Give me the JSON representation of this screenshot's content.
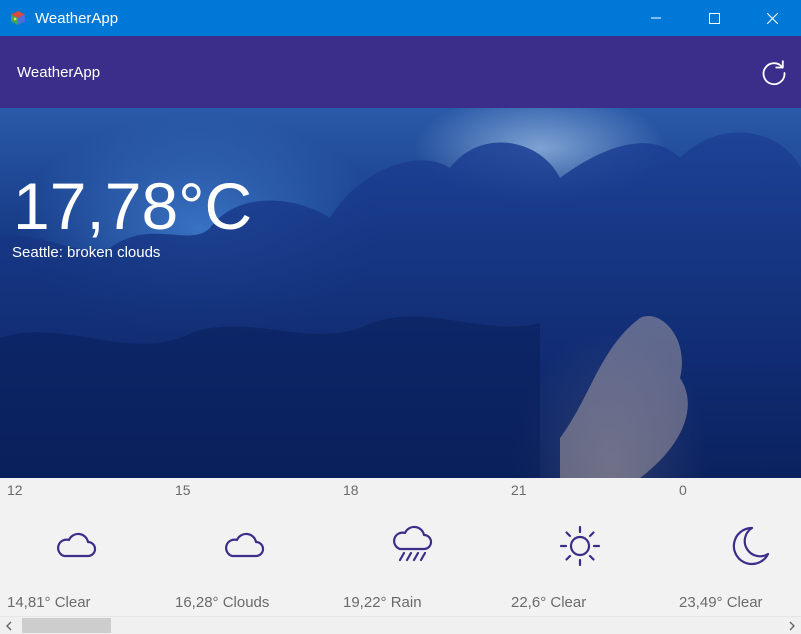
{
  "window": {
    "title": "WeatherApp",
    "titlebar_color": "#0078d7",
    "controls": [
      "minimize-icon",
      "maximize-icon",
      "close-icon"
    ]
  },
  "header": {
    "title": "WeatherApp",
    "background": "#3b2d8a",
    "refresh_icon": "refresh-icon"
  },
  "current": {
    "temperature": "17,78°C",
    "description": "Seattle: broken clouds"
  },
  "forecast": {
    "accent": "#3b2d8a",
    "items": [
      {
        "hour": "12",
        "icon": "cloud-icon",
        "summary": "14,81° Clear"
      },
      {
        "hour": "15",
        "icon": "cloud-icon",
        "summary": "16,28° Clouds"
      },
      {
        "hour": "18",
        "icon": "rain-cloud-icon",
        "summary": "19,22° Rain"
      },
      {
        "hour": "21",
        "icon": "sun-icon",
        "summary": "22,6° Clear"
      },
      {
        "hour": "0",
        "icon": "moon-icon",
        "summary": "23,49° Clear"
      }
    ]
  }
}
